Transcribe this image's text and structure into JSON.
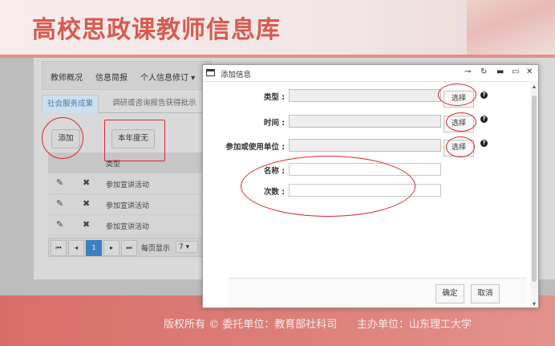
{
  "header": {
    "title": "高校思政课教师信息库"
  },
  "topnav": {
    "items": [
      "教师概况",
      "信息简报",
      "个人信息修订 ▾"
    ]
  },
  "tabs": [
    "社会服务成果",
    "调研或咨询报告获得批示"
  ],
  "actions": {
    "add": "添加",
    "no_this_year": "本年度无"
  },
  "table": {
    "header": "类型",
    "rows": [
      {
        "type": "参加宣讲活动"
      },
      {
        "type": "参加宣讲活动"
      },
      {
        "type": "参加宣讲活动"
      }
    ]
  },
  "pager": {
    "current": "1",
    "per_page_label": "每页显示",
    "per_page": "7"
  },
  "modal": {
    "title": "添加信息",
    "fields": {
      "type_label": "类型 :",
      "time_label": "时间 :",
      "unit_label": "参加或使用单位 :",
      "name_label": "名称 :",
      "count_label": "次数 :"
    },
    "select_label": "选择",
    "confirm": "确定",
    "cancel": "取消"
  },
  "footer": {
    "text": "版权所有 © 委托单位：教育部社科司      主办单位：山东理工大学"
  },
  "colors": {
    "title": "#d85a4f",
    "footer": "#d86e6a",
    "annotation": "#d9262a",
    "active_page": "#3d7fc0"
  }
}
